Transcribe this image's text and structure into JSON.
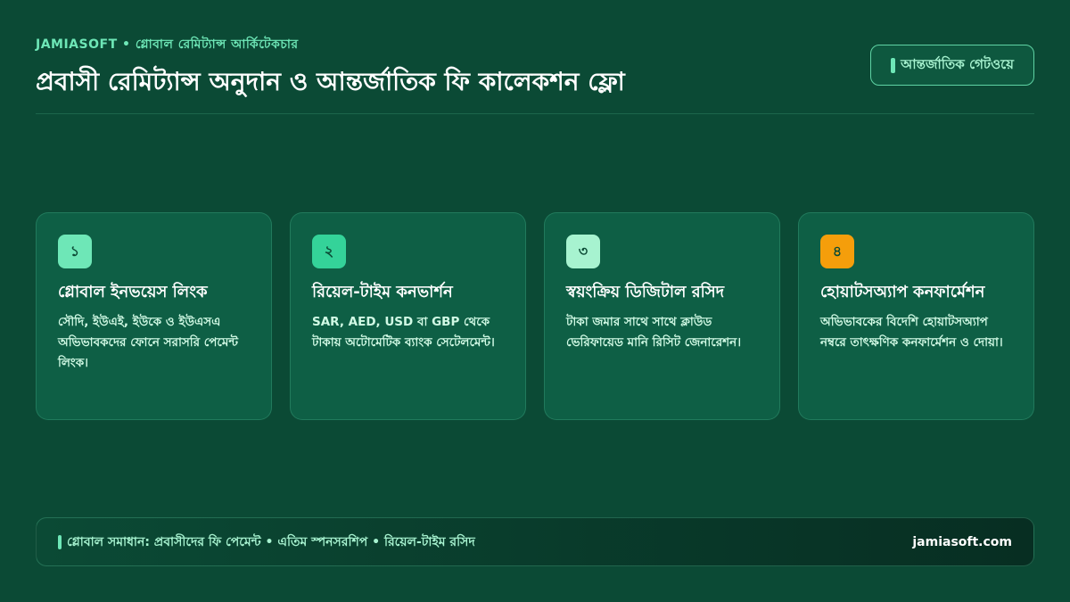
{
  "header": {
    "eyebrow": "JAMIASOFT • গ্লোবাল রেমিট্যান্স আর্কিটেকচার",
    "title": "প্রবাসী রেমিট্যান্স অনুদান ও আন্তর্জাতিক ফি কালেকশন ফ্লো",
    "badge_icon": "vertical-bar-icon",
    "badge_label": "আন্তর্জাতিক গেটওয়ে"
  },
  "cards": [
    {
      "step": "১",
      "step_color": "#6ee7b7",
      "title": "গ্লোবাল ইনভয়েস লিংক",
      "desc": "সৌদি, ইউএই, ইউকে ও ইউএসএ অভিভাবকদের ফোনে সরাসরি পেমেন্ট লিংক।"
    },
    {
      "step": "২",
      "step_color": "#34d399",
      "title": "রিয়েল-টাইম কনভার্শন",
      "desc": "SAR, AED, USD বা GBP থেকে টাকায় অটোমেটিক ব্যাংক সেটেলমেন্ট।"
    },
    {
      "step": "৩",
      "step_color": "#a7f3d0",
      "title": "স্বয়ংক্রিয় ডিজিটাল রসিদ",
      "desc": "টাকা জমার সাথে সাথে ক্লাউড ভেরিফায়েড মানি রিসিট জেনারেশন।"
    },
    {
      "step": "৪",
      "step_color": "#f59e0b",
      "title": "হোয়াটসঅ্যাপ কনফার্মেশন",
      "desc": "অভিভাবকের বিদেশি হোয়াটসঅ্যাপ নম্বরে তাৎক্ষণিক কনফার্মেশন ও দোয়া।"
    }
  ],
  "footer": {
    "text": "গ্লোবাল সমাধান: প্রবাসীদের ফি পেমেন্ট • এতিম স্পনসরশিপ • রিয়েল-টাইম রসিদ",
    "site": "jamiasoft.com"
  }
}
